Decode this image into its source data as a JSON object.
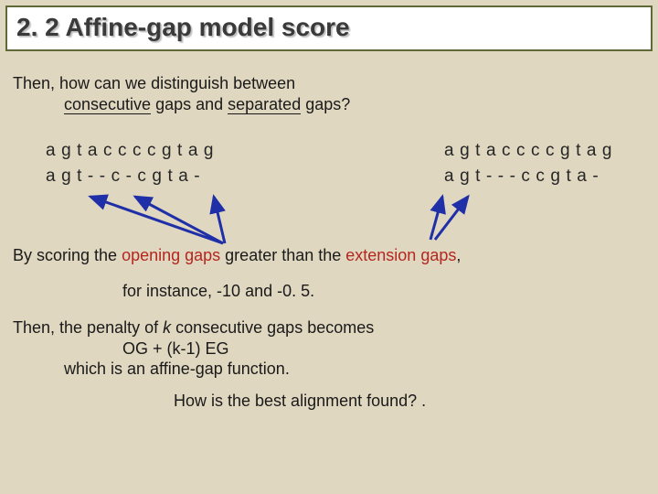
{
  "title": "2. 2 Affine-gap model score",
  "intro": {
    "line1": "Then, how can we distinguish between",
    "line2_a": "consecutive",
    "line2_b": " gaps and ",
    "line2_c": "separated",
    "line2_d": " gaps?"
  },
  "align_left": {
    "seq1": "agtaccccgtag",
    "seq2": "agt--c-cgta-"
  },
  "align_right": {
    "seq1": "agtaccccgtag",
    "seq2": "agt---ccgta-"
  },
  "scoring": {
    "prefix": "By scoring the ",
    "open": "opening gaps",
    "mid": " greater than the ",
    "ext": "extension gaps",
    "suffix": ","
  },
  "instance": "for instance, -10 and -0. 5.",
  "penalty": {
    "l1_a": "Then, the penalty of ",
    "l1_k": "k",
    "l1_b": " consecutive gaps becomes",
    "l2": "OG + (k-1) EG",
    "l3": "which is an affine-gap function."
  },
  "closing": "How is the best alignment found? ."
}
